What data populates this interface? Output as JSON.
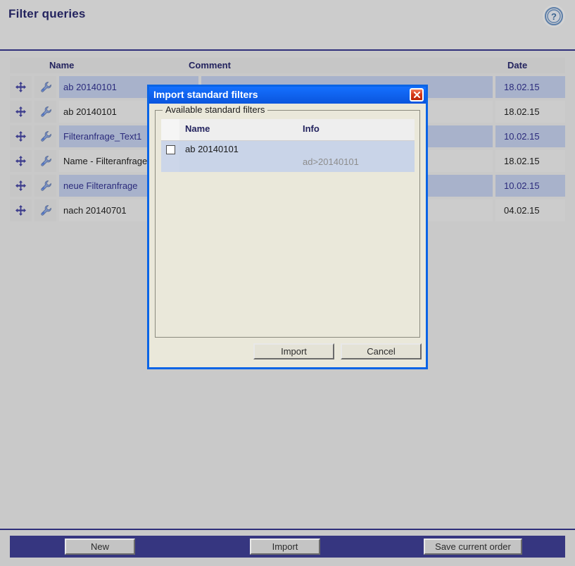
{
  "page": {
    "title": "Filter queries",
    "help_icon": "help-circle-icon"
  },
  "table": {
    "columns": {
      "name": "Name",
      "comment": "Comment",
      "date": "Date"
    },
    "row_icons": {
      "move": "move-handle-icon",
      "edit": "wrench-icon"
    },
    "rows": [
      {
        "name": "ab 20140101",
        "comment": "",
        "date": "18.02.15",
        "selected": true
      },
      {
        "name": "ab 20140101",
        "comment": "",
        "date": "18.02.15",
        "selected": false
      },
      {
        "name": "Filteranfrage_Text1",
        "comment": "",
        "date": "10.02.15",
        "selected": true
      },
      {
        "name": "Name - Filteranfrage",
        "comment": "",
        "date": "18.02.15",
        "selected": false
      },
      {
        "name": "neue Filteranfrage",
        "comment": "",
        "date": "10.02.15",
        "selected": true
      },
      {
        "name": "nach 20140701",
        "comment": "",
        "date": "04.02.15",
        "selected": false
      }
    ]
  },
  "bottom_bar": {
    "new_label": "New",
    "import_label": "Import",
    "save_label": "Save current order"
  },
  "dialog": {
    "title": "Import standard filters",
    "close_icon": "close-x-icon",
    "fieldset_legend": "Available standard filters",
    "columns": {
      "name": "Name",
      "info": "Info"
    },
    "rows": [
      {
        "name": "ab 20140101",
        "info": "ad>20140101",
        "checked": false
      }
    ],
    "import_label": "Import",
    "cancel_label": "Cancel"
  },
  "colors": {
    "page_bg": "#c9c9c9",
    "header_bg": "#cccccc",
    "accent_navy": "#23235e",
    "row_selected": "#a8b2cb",
    "row_normal": "#cccccc",
    "dialog_titlebar": "#0a5ef0",
    "dialog_body": "#eae8da",
    "dialog_border": "#0a64e6",
    "bottom_bar": "#363680",
    "close_button": "#d83a1a",
    "info_text": "#8d8d8d"
  }
}
